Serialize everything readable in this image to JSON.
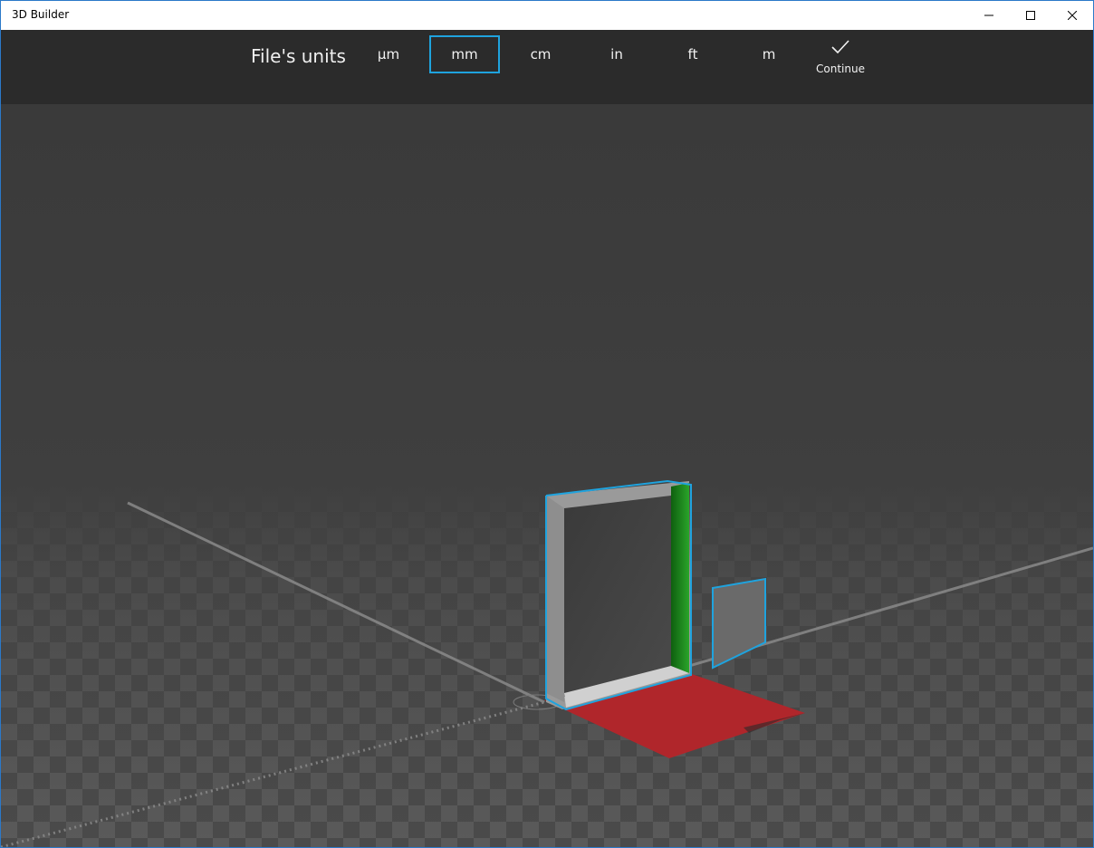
{
  "app": {
    "title": "3D Builder"
  },
  "window_controls": {
    "minimize": "minimize-icon",
    "maximize": "maximize-icon",
    "close": "close-icon"
  },
  "units_bar": {
    "title": "File's units",
    "units": [
      "µm",
      "mm",
      "cm",
      "in",
      "ft",
      "m"
    ],
    "selected": "mm",
    "continue_label": "Continue",
    "continue_icon": "checkmark-icon"
  },
  "colors": {
    "accent": "#1fa3de",
    "toolbar_bg": "#2b2b2b",
    "viewport_bg": "#3c3c3c",
    "floor_shadow": "#b0262b",
    "model_side_green": "#1f8f1f"
  }
}
